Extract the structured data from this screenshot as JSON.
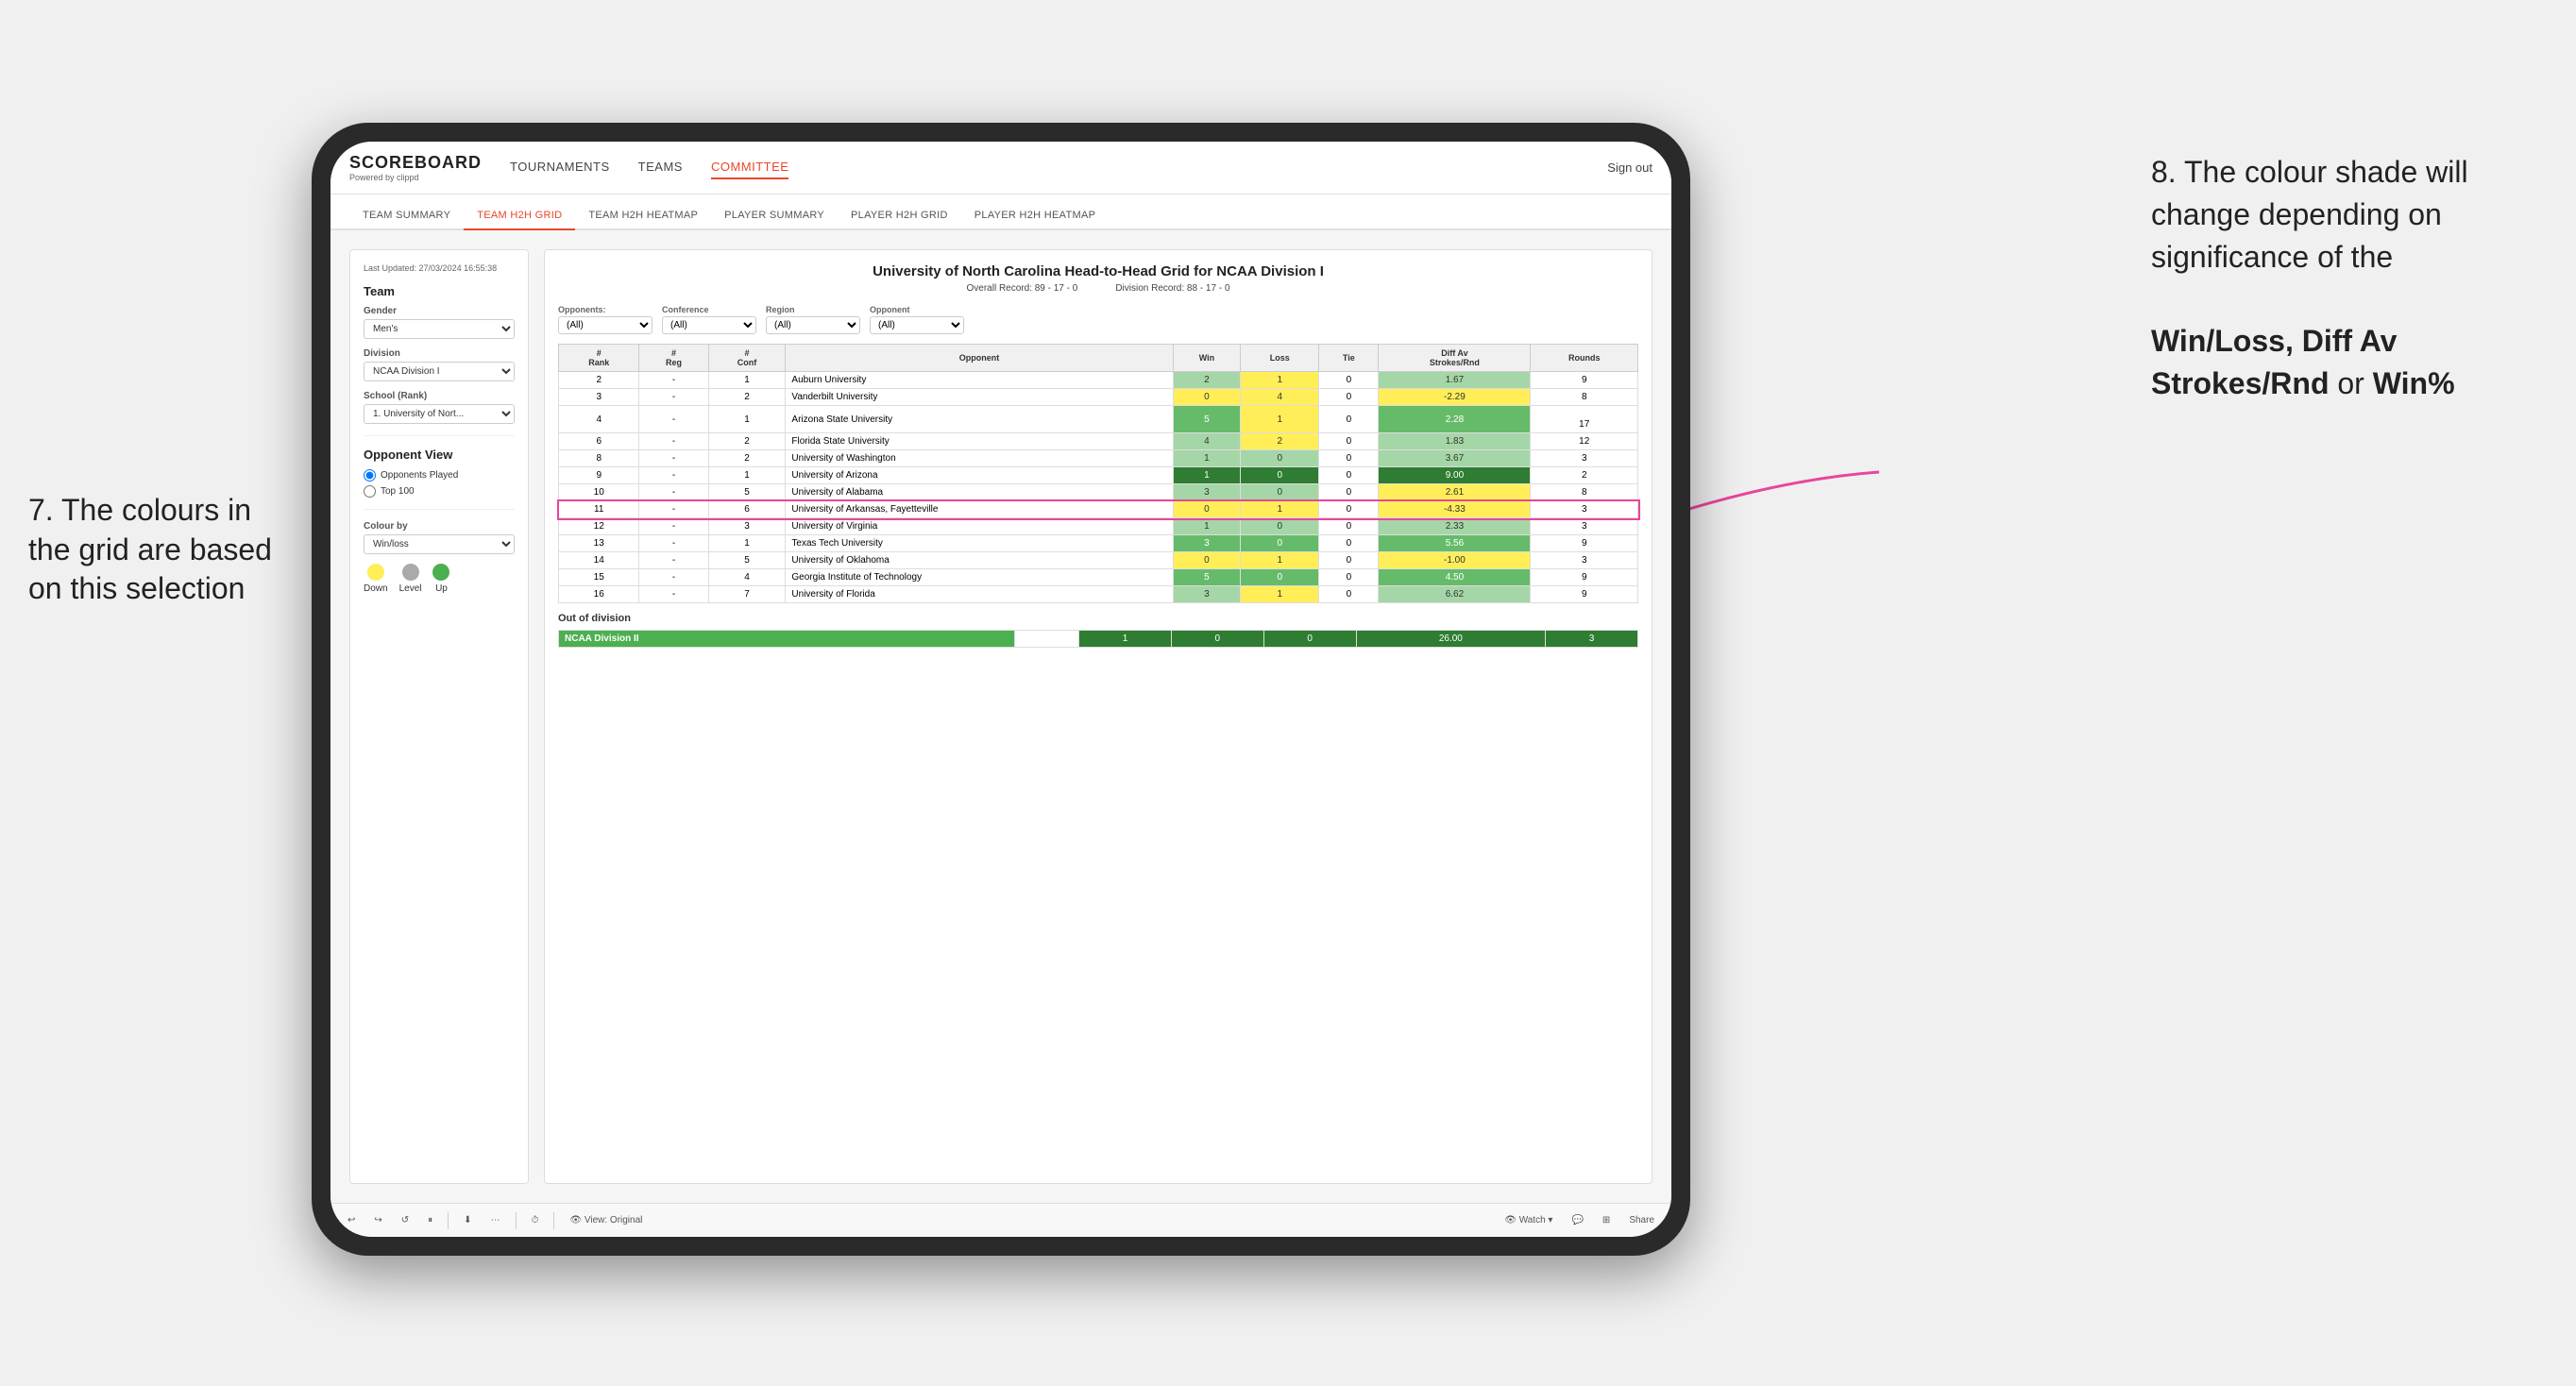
{
  "annotations": {
    "left_title": "7. The colours in the grid are based on this selection",
    "right_title": "8. The colour shade will change depending on significance of the",
    "right_bold1": "Win/Loss",
    "right_bold2": "Diff Av Strokes/Rnd",
    "right_bold3": "Win%",
    "right_connector": " or "
  },
  "header": {
    "logo": "SCOREBOARD",
    "logo_sub": "Powered by clippd",
    "nav": [
      "TOURNAMENTS",
      "TEAMS",
      "COMMITTEE"
    ],
    "sign_out": "Sign out"
  },
  "sub_tabs": [
    "TEAM SUMMARY",
    "TEAM H2H GRID",
    "TEAM H2H HEATMAP",
    "PLAYER SUMMARY",
    "PLAYER H2H GRID",
    "PLAYER H2H HEATMAP"
  ],
  "active_sub_tab": "TEAM H2H GRID",
  "sidebar": {
    "last_updated": "Last Updated: 27/03/2024\n16:55:38",
    "team_label": "Team",
    "gender_label": "Gender",
    "gender_value": "Men's",
    "division_label": "Division",
    "division_value": "NCAA Division I",
    "school_label": "School (Rank)",
    "school_value": "1. University of Nort...",
    "opponent_view_label": "Opponent View",
    "opponents_played": "Opponents Played",
    "top_100": "Top 100",
    "colour_by_label": "Colour by",
    "colour_by_value": "Win/loss",
    "legend": {
      "down_label": "Down",
      "level_label": "Level",
      "up_label": "Up"
    }
  },
  "grid": {
    "title": "University of North Carolina Head-to-Head Grid for NCAA Division I",
    "overall_record_label": "Overall Record:",
    "overall_record": "89 - 17 - 0",
    "division_record_label": "Division Record:",
    "division_record": "88 - 17 - 0",
    "filters": {
      "opponents_label": "Opponents:",
      "opponents_value": "(All)",
      "conference_label": "Conference",
      "conference_value": "(All)",
      "region_label": "Region",
      "region_value": "(All)",
      "opponent_label": "Opponent",
      "opponent_value": "(All)"
    },
    "table_headers": [
      "#\nRank",
      "#\nReg",
      "#\nConf",
      "Opponent",
      "Win",
      "Loss",
      "Tie",
      "Diff Av\nStrokes/Rnd",
      "Rounds"
    ],
    "rows": [
      {
        "rank": "2",
        "reg": "-",
        "conf": "1",
        "opponent": "Auburn University",
        "win": "2",
        "loss": "1",
        "tie": "0",
        "diff": "1.67",
        "rounds": "9",
        "win_color": "green-light",
        "diff_color": "green-light"
      },
      {
        "rank": "3",
        "reg": "",
        "conf": "2",
        "opponent": "Vanderbilt University",
        "win": "0",
        "loss": "4",
        "tie": "0",
        "diff": "-2.29",
        "rounds": "8",
        "win_color": "yellow",
        "diff_color": "yellow"
      },
      {
        "rank": "4",
        "reg": "-",
        "conf": "1",
        "opponent": "Arizona State University",
        "win": "5",
        "loss": "1",
        "tie": "0",
        "diff": "2.28",
        "rounds": "",
        "rounds2": "17",
        "win_color": "green-mid",
        "diff_color": "green-mid"
      },
      {
        "rank": "6",
        "reg": "-",
        "conf": "2",
        "opponent": "Florida State University",
        "win": "4",
        "loss": "2",
        "tie": "0",
        "diff": "1.83",
        "rounds": "12",
        "win_color": "green-light",
        "diff_color": "green-light"
      },
      {
        "rank": "8",
        "reg": "-",
        "conf": "2",
        "opponent": "University of Washington",
        "win": "1",
        "loss": "0",
        "tie": "0",
        "diff": "3.67",
        "rounds": "3",
        "win_color": "green-light",
        "diff_color": "green-light"
      },
      {
        "rank": "9",
        "reg": "-",
        "conf": "1",
        "opponent": "University of Arizona",
        "win": "1",
        "loss": "0",
        "tie": "0",
        "diff": "9.00",
        "rounds": "2",
        "win_color": "green-dark",
        "diff_color": "green-dark"
      },
      {
        "rank": "10",
        "reg": "-",
        "conf": "5",
        "opponent": "University of Alabama",
        "win": "3",
        "loss": "0",
        "tie": "0",
        "diff": "2.61",
        "rounds": "8",
        "win_color": "green-light",
        "diff_color": "yellow"
      },
      {
        "rank": "11",
        "reg": "-",
        "conf": "6",
        "opponent": "University of Arkansas, Fayetteville",
        "win": "0",
        "loss": "1",
        "tie": "0",
        "diff": "-4.33",
        "rounds": "3",
        "win_color": "yellow",
        "diff_color": "yellow",
        "highlight": true
      },
      {
        "rank": "12",
        "reg": "-",
        "conf": "3",
        "opponent": "University of Virginia",
        "win": "1",
        "loss": "0",
        "tie": "0",
        "diff": "2.33",
        "rounds": "3",
        "win_color": "green-light",
        "diff_color": "green-light"
      },
      {
        "rank": "13",
        "reg": "-",
        "conf": "1",
        "opponent": "Texas Tech University",
        "win": "3",
        "loss": "0",
        "tie": "0",
        "diff": "5.56",
        "rounds": "9",
        "win_color": "green-mid",
        "diff_color": "green-mid"
      },
      {
        "rank": "14",
        "reg": "-",
        "conf": "5",
        "opponent": "University of Oklahoma",
        "win": "0",
        "loss": "1",
        "tie": "0",
        "diff": "-1.00",
        "rounds": "3",
        "win_color": "yellow",
        "diff_color": "yellow"
      },
      {
        "rank": "15",
        "reg": "-",
        "conf": "4",
        "opponent": "Georgia Institute of Technology",
        "win": "5",
        "loss": "0",
        "tie": "0",
        "diff": "4.50",
        "rounds": "9",
        "win_color": "green-mid",
        "diff_color": "green-mid"
      },
      {
        "rank": "16",
        "reg": "-",
        "conf": "7",
        "opponent": "University of Florida",
        "win": "3",
        "loss": "1",
        "tie": "0",
        "diff": "6.62",
        "rounds": "9",
        "win_color": "green-light",
        "diff_color": "green-light"
      }
    ],
    "out_of_division": {
      "title": "Out of division",
      "rows": [
        {
          "division": "NCAA Division II",
          "win": "1",
          "loss": "0",
          "tie": "0",
          "diff": "26.00",
          "rounds": "3",
          "win_color": "green-dark",
          "diff_color": "green-dark"
        }
      ]
    }
  },
  "toolbar": {
    "view_label": "View: Original",
    "watch_label": "Watch",
    "share_label": "Share"
  }
}
